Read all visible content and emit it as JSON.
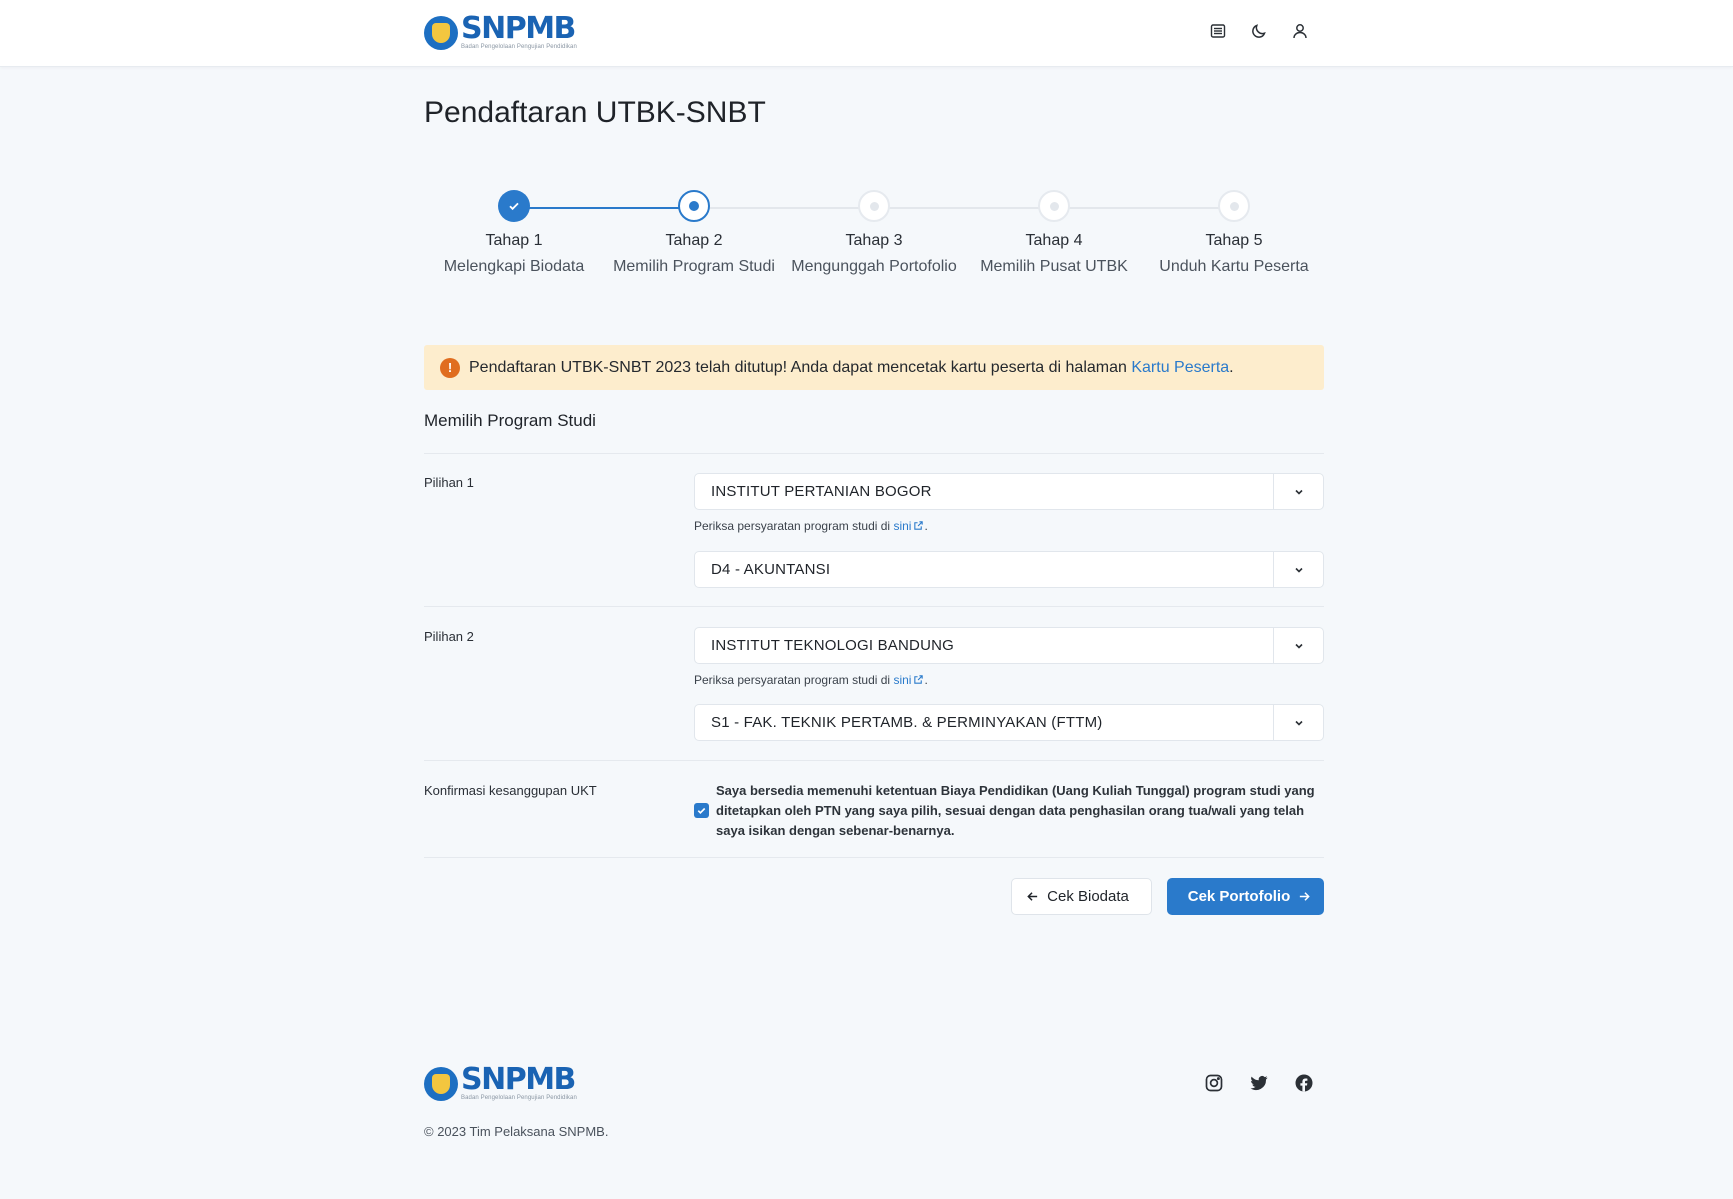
{
  "header": {
    "logo_text": "SNPMB",
    "logo_tagline": "Badan Pengelolaan Pengujian Pendidikan",
    "icons": [
      "list-icon",
      "moon-icon",
      "user-icon"
    ]
  },
  "page": {
    "title": "Pendaftaran UTBK-SNBT"
  },
  "stepper": {
    "steps": [
      {
        "title": "Tahap 1",
        "subtitle": "Melengkapi Biodata",
        "state": "done"
      },
      {
        "title": "Tahap 2",
        "subtitle": "Memilih Program Studi",
        "state": "current"
      },
      {
        "title": "Tahap 3",
        "subtitle": "Mengunggah Portofolio",
        "state": "todo"
      },
      {
        "title": "Tahap 4",
        "subtitle": "Memilih Pusat UTBK",
        "state": "todo"
      },
      {
        "title": "Tahap 5",
        "subtitle": "Unduh Kartu Peserta",
        "state": "todo"
      }
    ]
  },
  "alert": {
    "text": "Pendaftaran UTBK-SNBT 2023 telah ditutup! Anda dapat mencetak kartu peserta di halaman ",
    "link": "Kartu Peserta",
    "suffix": ".",
    "icon": "!"
  },
  "form": {
    "section_title": "Memilih Program Studi",
    "choice1": {
      "label": "Pilihan 1",
      "university": "INSTITUT PERTANIAN BOGOR",
      "hint_text": "Periksa persyaratan program studi di ",
      "hint_link": "sini",
      "hint_suffix": ".",
      "program": "D4 - AKUNTANSI"
    },
    "choice2": {
      "label": "Pilihan 2",
      "university": "INSTITUT TEKNOLOGI BANDUNG",
      "hint_text": "Periksa persyaratan program studi di ",
      "hint_link": "sini",
      "hint_suffix": ".",
      "program": "S1 - FAK. TEKNIK PERTAMB. & PERMINYAKAN (FTTM)"
    },
    "ukt": {
      "label": "Konfirmasi kesanggupan UKT",
      "checked": true,
      "text": "Saya bersedia memenuhi ketentuan Biaya Pendidikan (Uang Kuliah Tunggal) program studi yang ditetapkan oleh PTN yang saya pilih, sesuai dengan data penghasilan orang tua/wali yang telah saya isikan dengan sebenar-benarnya."
    }
  },
  "actions": {
    "back_label": "Cek Biodata",
    "next_label": "Cek Portofolio"
  },
  "footer": {
    "logo_text": "SNPMB",
    "logo_tagline": "Badan Pengelolaan Pengujian Pendidikan",
    "copyright": "© 2023 Tim Pelaksana SNPMB.",
    "social_icons": [
      "instagram-icon",
      "twitter-icon",
      "facebook-icon"
    ]
  },
  "colors": {
    "primary": "#2a7acb",
    "alert_bg": "#fdedcd",
    "alert_icon": "#e06d1f",
    "page_bg": "#f5f8fb"
  }
}
